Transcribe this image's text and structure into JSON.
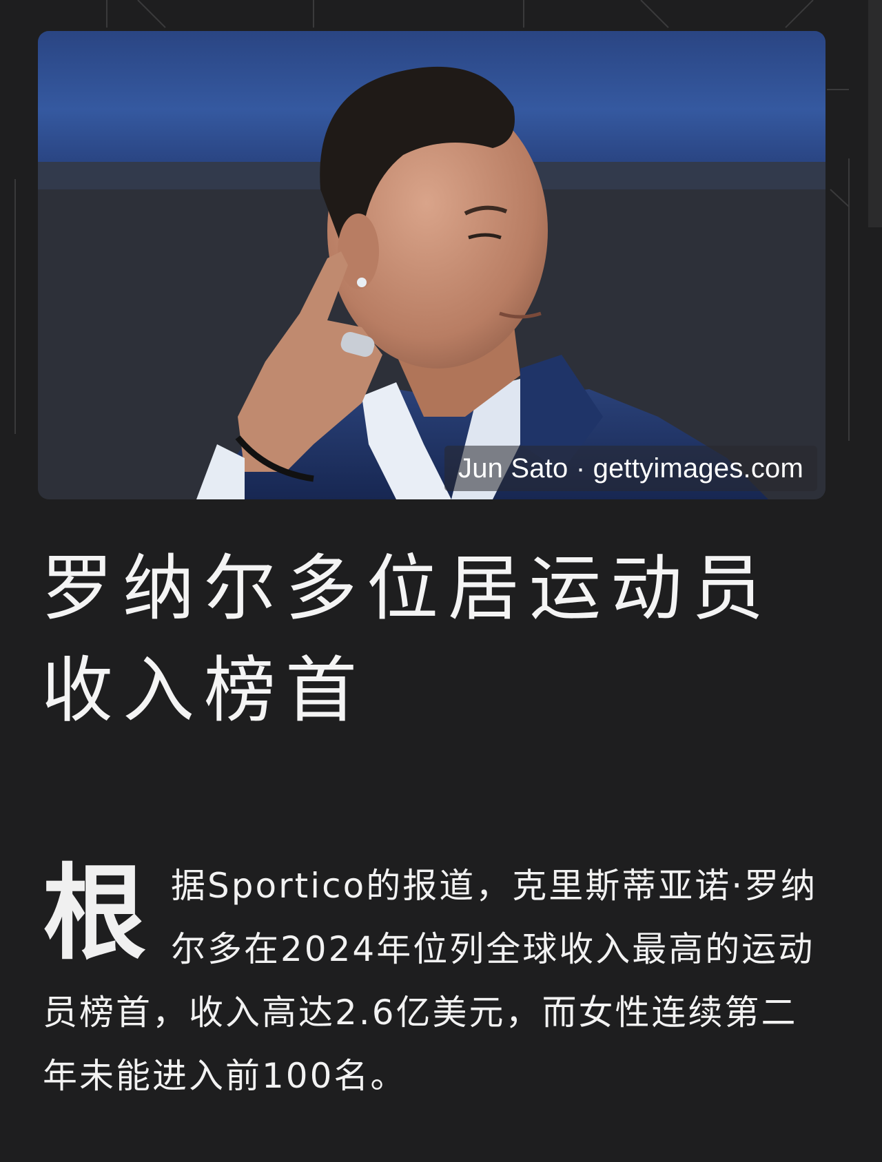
{
  "photo": {
    "alt": "",
    "credit": "Jun Sato · gettyimages.com"
  },
  "article": {
    "title": "罗纳尔多位居运动员收入榜首",
    "dropcap": "根",
    "body": "据Sportico的报道，克里斯蒂亚诺·罗纳尔多在2024年位列全球收入最高的运动员榜首，收入高达2.6亿美元，而女性连续第二年未能进入前100名。"
  },
  "colors": {
    "background": "#1e1e1f",
    "text": "#f2f2f2",
    "photo_top_band": "#2e4f92",
    "photo_backdrop": "#2d3039",
    "suit": "#1f3468"
  }
}
